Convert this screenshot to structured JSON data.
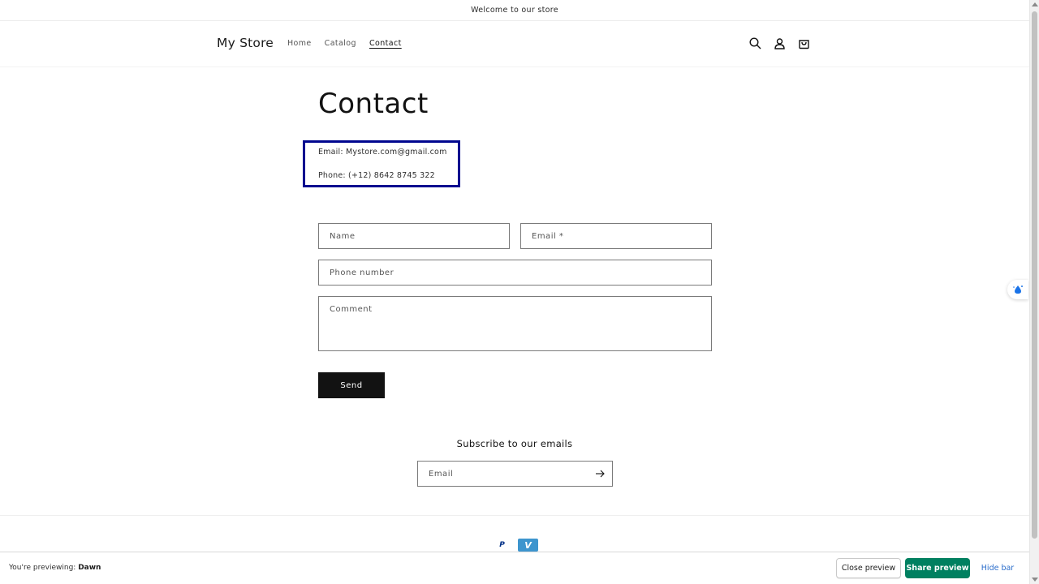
{
  "announcement": {
    "text": "Welcome to our store"
  },
  "header": {
    "logo": "My Store",
    "nav": [
      {
        "label": "Home"
      },
      {
        "label": "Catalog"
      },
      {
        "label": "Contact"
      }
    ],
    "icons": [
      "search-icon",
      "account-icon",
      "cart-icon"
    ]
  },
  "main": {
    "title": "Contact",
    "email_line": "Email: Mystore.com@gmail.com",
    "phone_line": "Phone: (+12) 8642 8745 322",
    "highlight_color": "#00068f",
    "form": {
      "name_placeholder": "Name",
      "email_placeholder": "Email *",
      "phone_placeholder": "Phone number",
      "comment_placeholder": "Comment",
      "send_label": "Send"
    }
  },
  "subscribe": {
    "title": "Subscribe to our emails",
    "email_placeholder": "Email"
  },
  "payment": {
    "paypal_label": "P",
    "venmo_label": "V"
  },
  "preview_bar": {
    "prefix": "You're previewing:",
    "theme": "Dawn",
    "close_label": "Close preview",
    "share_label": "Share preview",
    "hide_label": "Hide bar",
    "share_color": "#008060"
  }
}
